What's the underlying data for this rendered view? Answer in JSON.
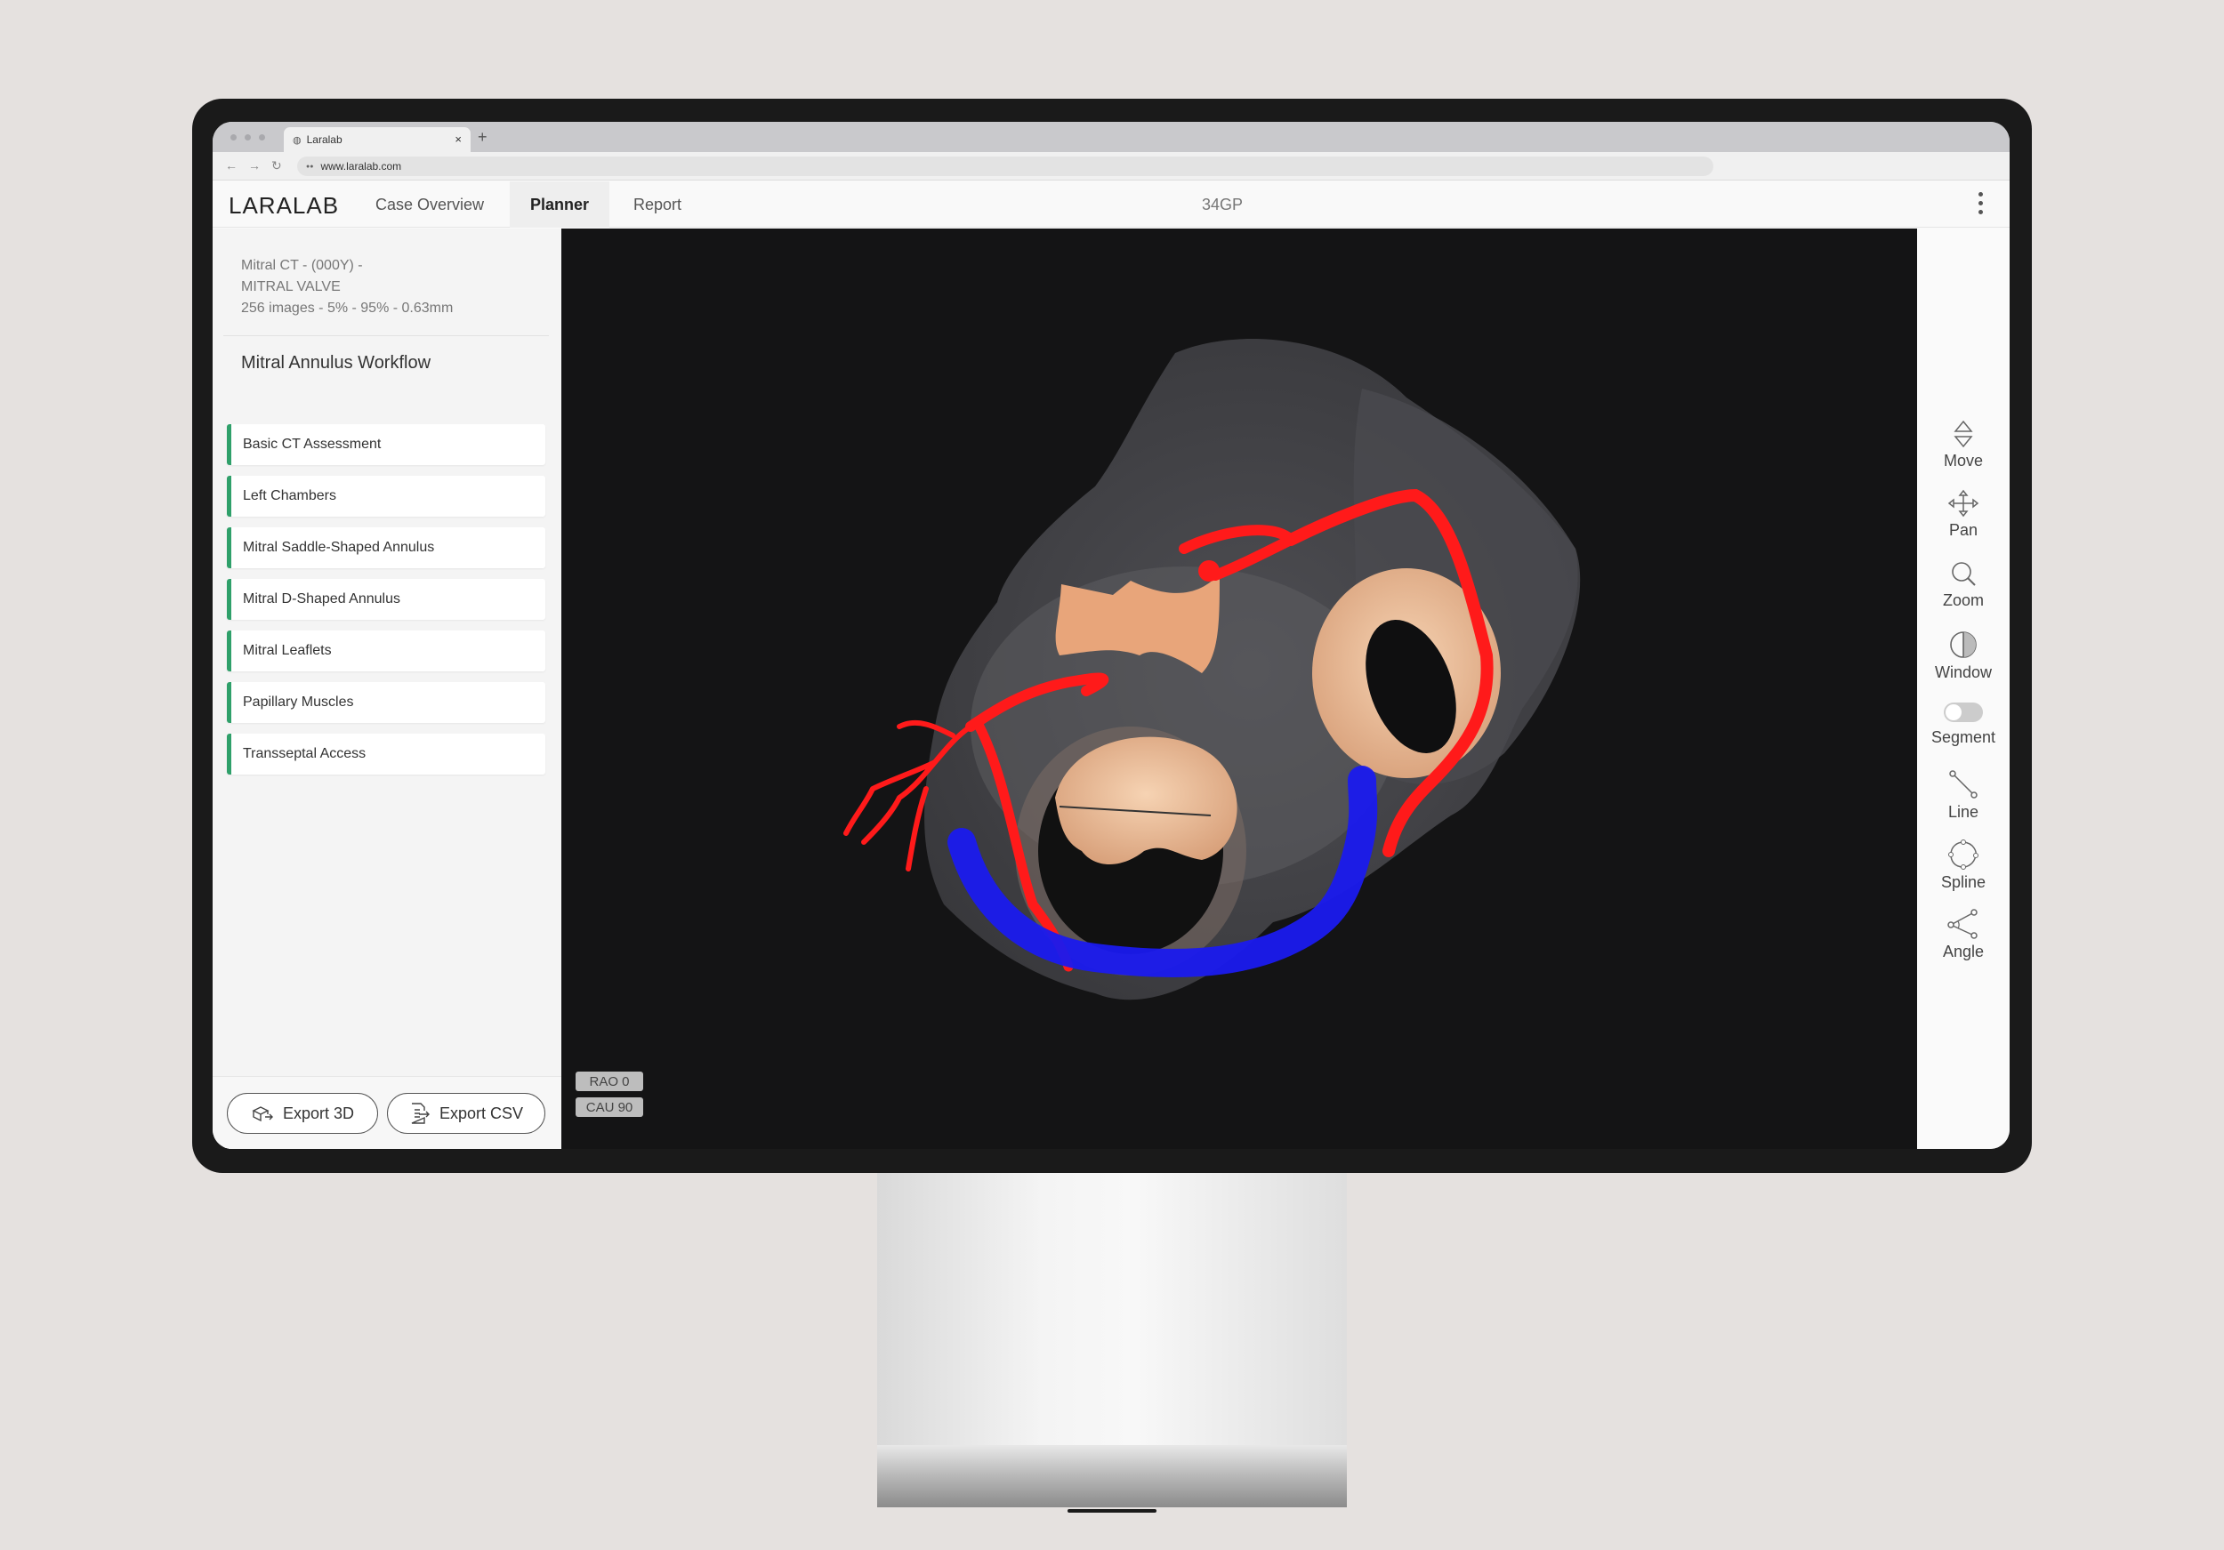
{
  "browser": {
    "tab_title": "Laralab",
    "tab_close": "×",
    "new_tab": "+",
    "url": "www.laralab.com"
  },
  "app": {
    "logo": "LARALAB",
    "tabs": [
      {
        "label": "Case Overview"
      },
      {
        "label": "Planner",
        "active": true
      },
      {
        "label": "Report"
      }
    ],
    "case_id": "34GP"
  },
  "study": {
    "line1": "Mitral CT - (000Y) -",
    "line2": "MITRAL VALVE",
    "line3": "256 images - 5% - 95% - 0.63mm"
  },
  "workflow": {
    "title": "Mitral Annulus Workflow",
    "steps": [
      {
        "label": "Basic CT Assessment"
      },
      {
        "label": "Left Chambers"
      },
      {
        "label": "Mitral Saddle-Shaped Annulus"
      },
      {
        "label": "Mitral D-Shaped Annulus"
      },
      {
        "label": "Mitral Leaflets"
      },
      {
        "label": "Papillary Muscles"
      },
      {
        "label": "Transseptal Access"
      }
    ],
    "step_accent": "#2fa06a"
  },
  "export": {
    "export_3d": "Export 3D",
    "export_csv": "Export CSV"
  },
  "viewport": {
    "rao": "RAO 0",
    "cau": "CAU 90",
    "colors": {
      "artery": "#ff1a1a",
      "vein": "#1a1aee",
      "valve": "#f2c29c",
      "tissue": "#6b6b6e"
    }
  },
  "tools": [
    {
      "label": "Move",
      "icon": "move-icon"
    },
    {
      "label": "Pan",
      "icon": "pan-icon"
    },
    {
      "label": "Zoom",
      "icon": "zoom-icon"
    },
    {
      "label": "Window",
      "icon": "window-icon"
    },
    {
      "label": "Segment",
      "icon": "toggle-icon"
    },
    {
      "label": "Line",
      "icon": "line-icon"
    },
    {
      "label": "Spline",
      "icon": "spline-icon"
    },
    {
      "label": "Angle",
      "icon": "angle-icon"
    }
  ]
}
